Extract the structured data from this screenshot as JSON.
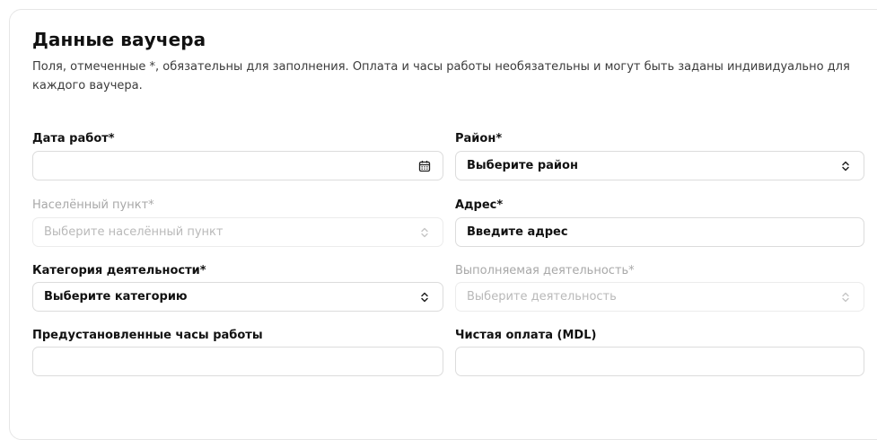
{
  "form": {
    "title": "Данные ваучера",
    "description": "Поля, отмеченные *, обязательны для заполнения. Оплата и часы работы необязательны и могут быть заданы индивидуально для каждого ваучера.",
    "fields": {
      "work_date": {
        "label": "Дата работ*",
        "value": "",
        "icon": "calendar-icon"
      },
      "district": {
        "label": "Район*",
        "value": "Выберите район",
        "icon": "chevron-updown-icon"
      },
      "locality": {
        "label": "Населённый пункт*",
        "value": "Выберите населённый пункт",
        "icon": "chevron-updown-icon",
        "disabled": true
      },
      "address": {
        "label": "Адрес*",
        "placeholder": "Введите адрес"
      },
      "activity_category": {
        "label": "Категория деятельности*",
        "value": "Выберите категорию",
        "icon": "chevron-updown-icon"
      },
      "performed_activity": {
        "label": "Выполняемая деятельность*",
        "value": "Выберите деятельность",
        "icon": "chevron-updown-icon",
        "disabled": true
      },
      "preset_hours": {
        "label": "Предустановленные часы работы",
        "value": ""
      },
      "net_pay": {
        "label": "Чистая оплата (MDL)",
        "value": ""
      }
    }
  },
  "colors": {
    "text": "#111111",
    "muted": "#a8a8a8",
    "border": "#dcdcdc",
    "card_border": "#e6e6e6"
  }
}
